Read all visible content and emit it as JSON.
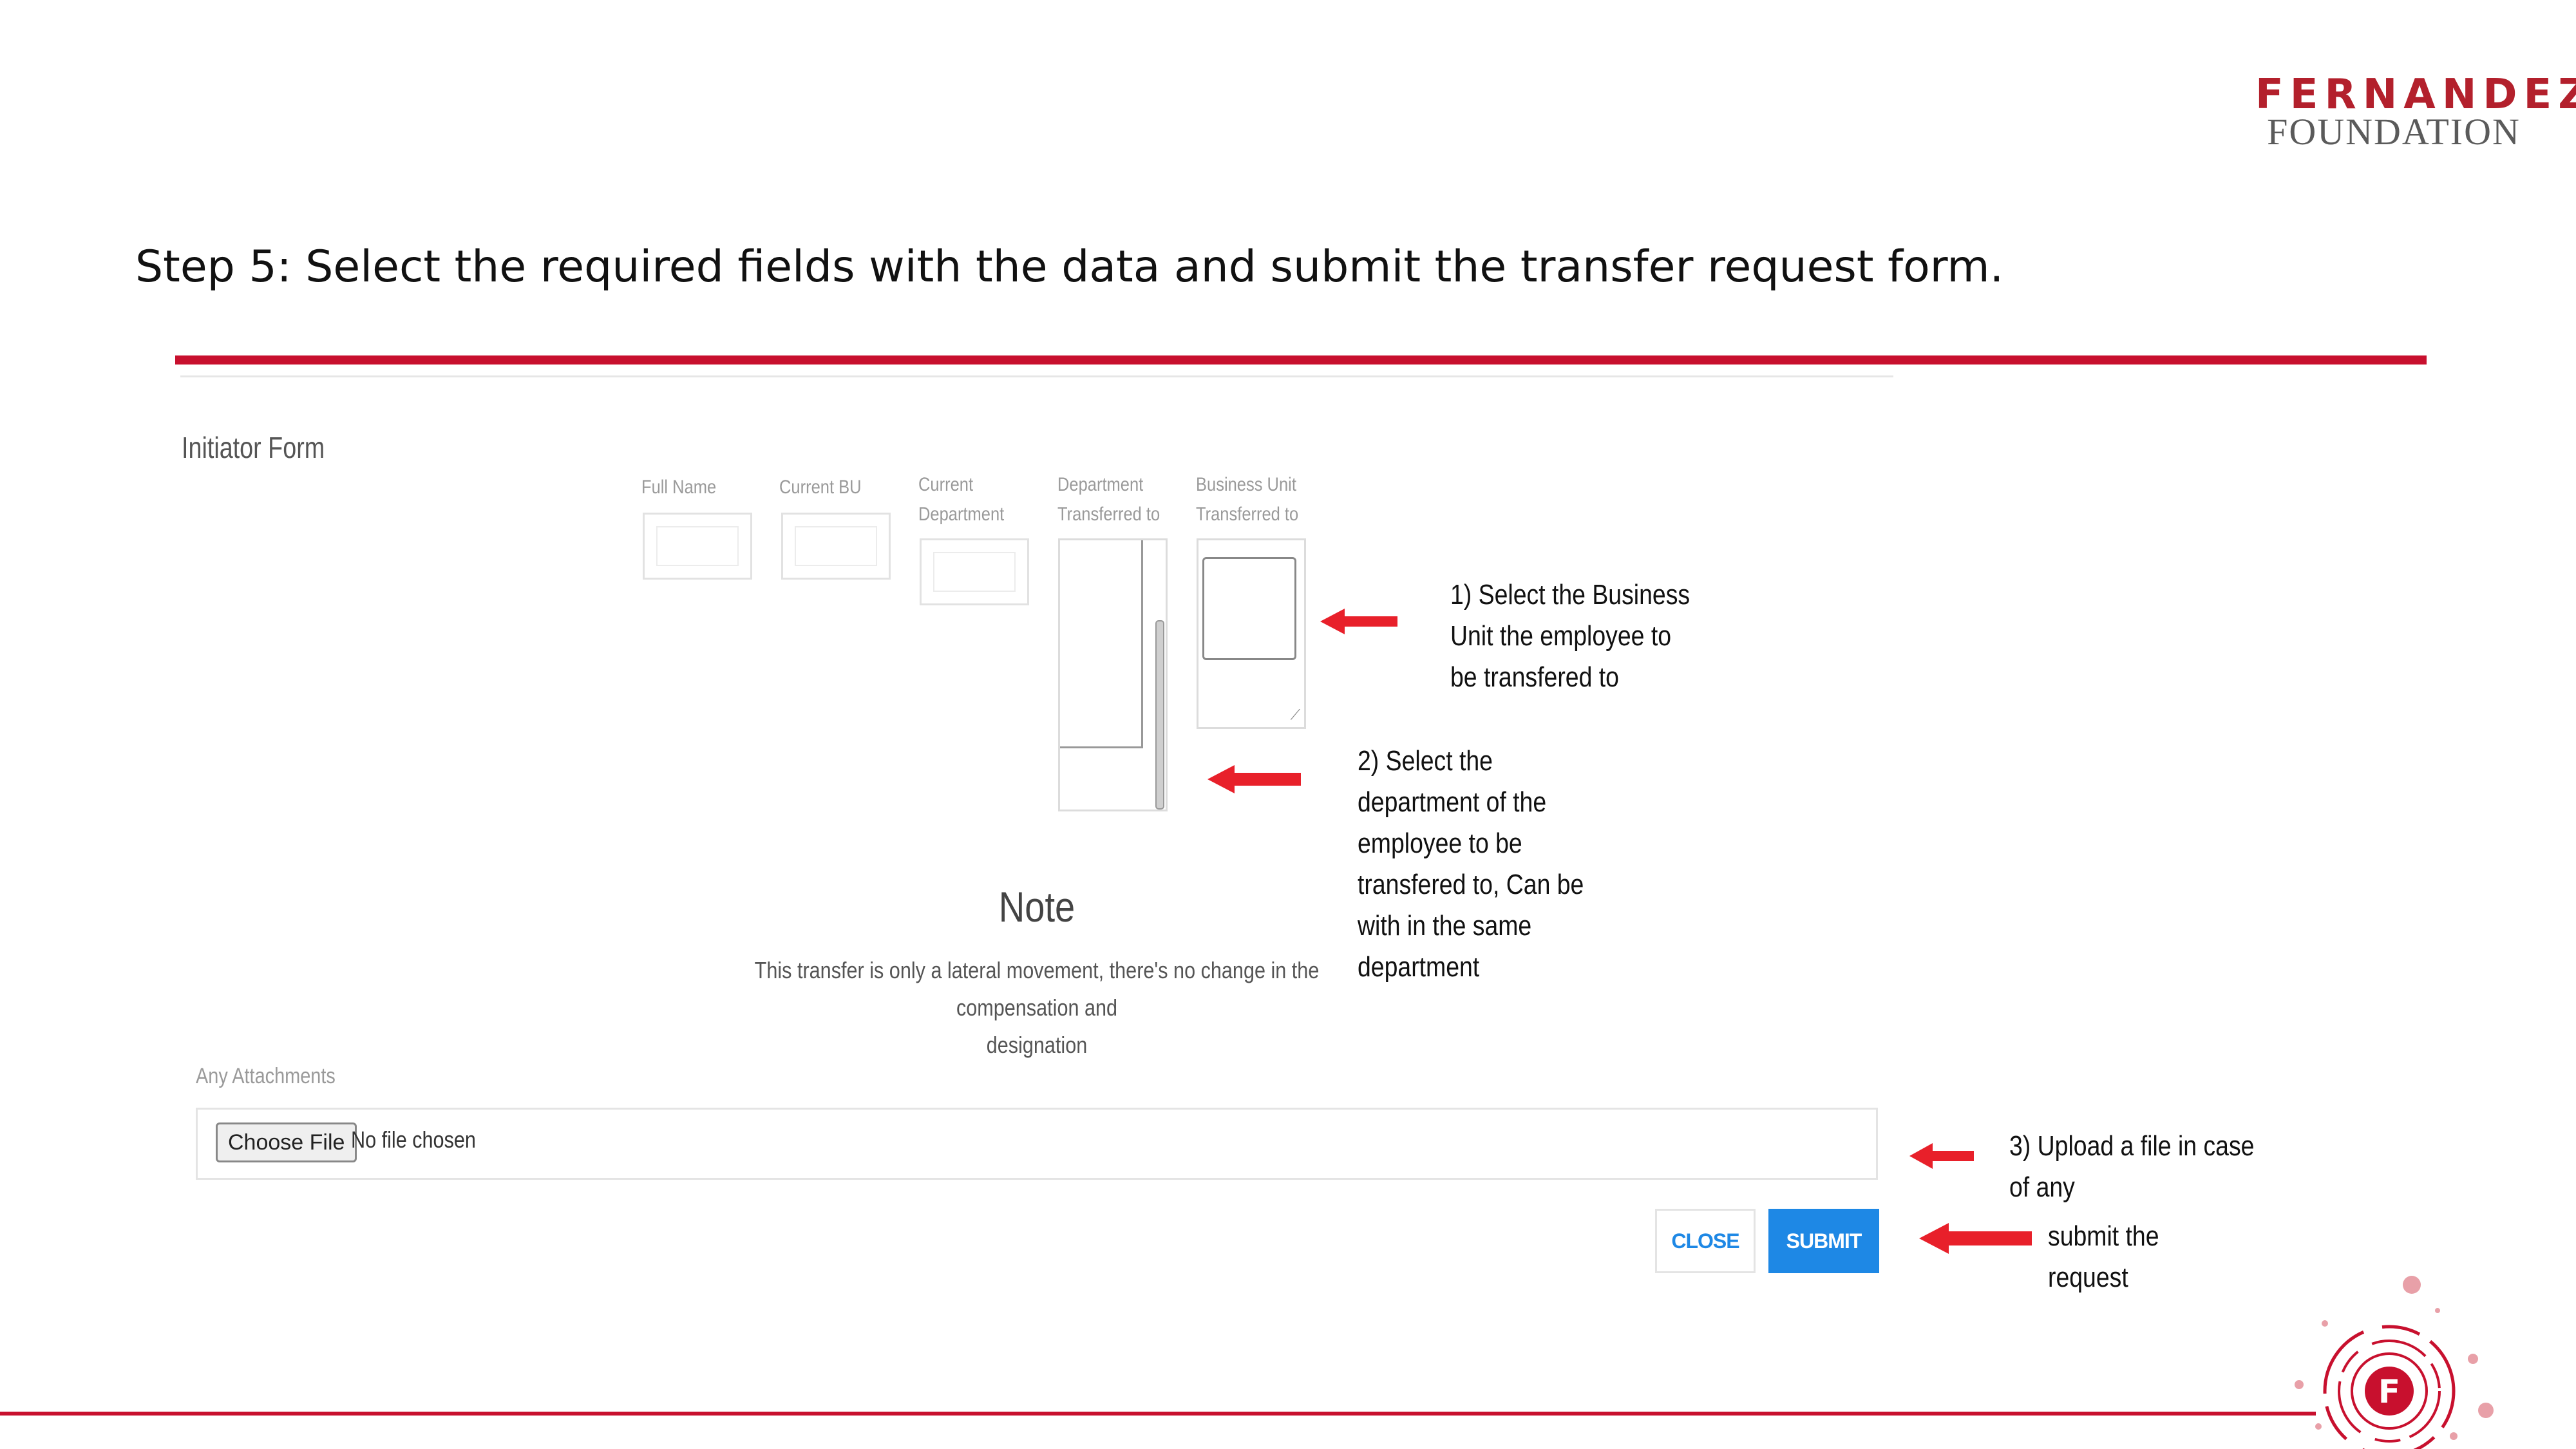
{
  "brand": {
    "line1": "FERNANDEZ",
    "line2": "FOUNDATION",
    "accent_color": "#c8102e"
  },
  "heading": "Step 5: Select the required fields with the data and submit the transfer request form.",
  "form": {
    "title": "Initiator Form",
    "fields": {
      "full_name": "Full Name",
      "current_bu": "Current BU",
      "current_department_1": "Current",
      "current_department_2": "Department",
      "dept_transferred_1": "Department",
      "dept_transferred_2": "Transferred to",
      "bu_transferred_1": "Business Unit",
      "bu_transferred_2": "Transferred to"
    },
    "note": {
      "title": "Note",
      "line1": "This transfer is only a lateral movement, there's no change in the compensation and",
      "line2": "designation"
    },
    "attachments": {
      "label": "Any Attachments",
      "choose_button": "Choose File",
      "status": "No file chosen"
    },
    "buttons": {
      "close": "CLOSE",
      "submit": "SUBMIT",
      "submit_color": "#1e88e5"
    }
  },
  "annotations": {
    "a1": [
      "1) Select the Business",
      "Unit the employee to",
      "be transfered to"
    ],
    "a2": [
      "2) Select the",
      "department of the",
      "employee to be",
      "transfered to, Can be",
      "with in the same",
      "department"
    ],
    "a3": [
      "3) Upload a file in case",
      "of any"
    ],
    "a4": [
      "submit the",
      "request"
    ]
  },
  "icons": {
    "arrow": "red-left-arrow-icon",
    "logo_mark": "fernandez-f-emblem-icon"
  }
}
